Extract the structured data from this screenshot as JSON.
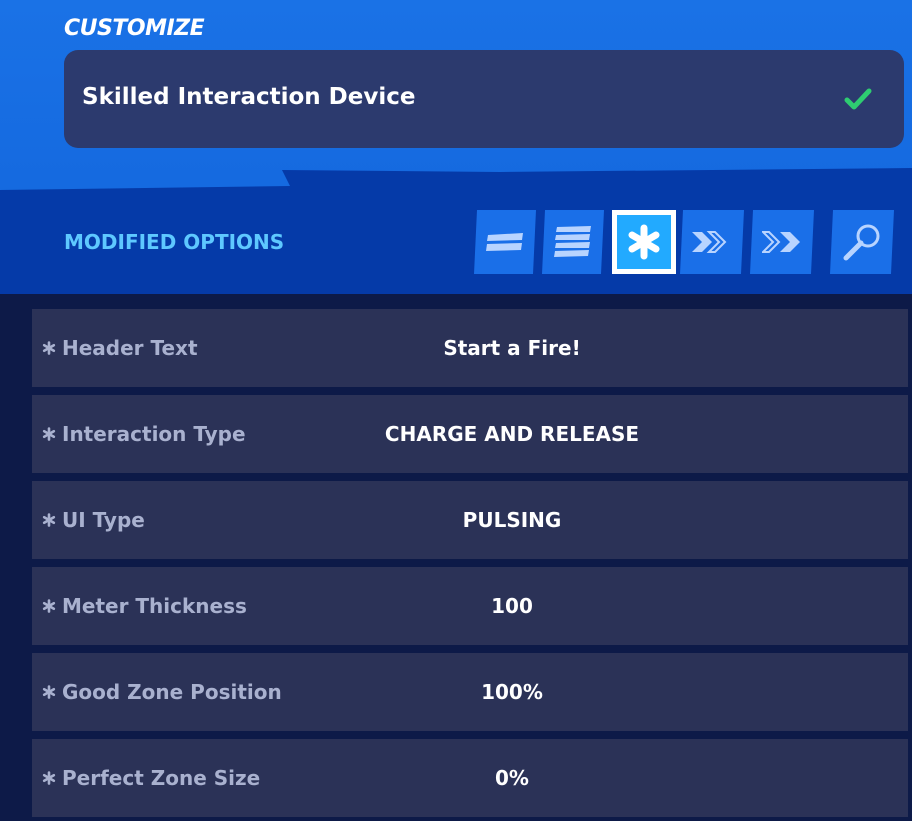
{
  "header": {
    "section_label": "CUSTOMIZE",
    "device_title": "Skilled Interaction Device",
    "confirm_icon": "check-icon"
  },
  "options_bar": {
    "label": "MODIFIED OPTIONS",
    "tabs": [
      {
        "icon": "double-bar-icon",
        "selected": false
      },
      {
        "icon": "list-icon",
        "selected": false
      },
      {
        "icon": "asterisk-icon",
        "selected": true
      },
      {
        "icon": "double-chevron-right-icon",
        "selected": false
      },
      {
        "icon": "double-chevron-outline-icon",
        "selected": false
      },
      {
        "icon": "search-icon",
        "selected": false
      }
    ]
  },
  "options": [
    {
      "label": "Header Text",
      "value": "Start a Fire!"
    },
    {
      "label": "Interaction Type",
      "value": "CHARGE AND RELEASE"
    },
    {
      "label": "UI Type",
      "value": "PULSING"
    },
    {
      "label": "Meter Thickness",
      "value": "100"
    },
    {
      "label": "Good Zone Position",
      "value": "100%"
    },
    {
      "label": "Perfect Zone Size",
      "value": "0%"
    }
  ],
  "colors": {
    "accent_blue": "#1a6fe8",
    "selected_tab": "#22aaff",
    "label_cyan": "#5ec8ff",
    "check_green": "#2ecc71",
    "row_bg": "#2b3257"
  }
}
